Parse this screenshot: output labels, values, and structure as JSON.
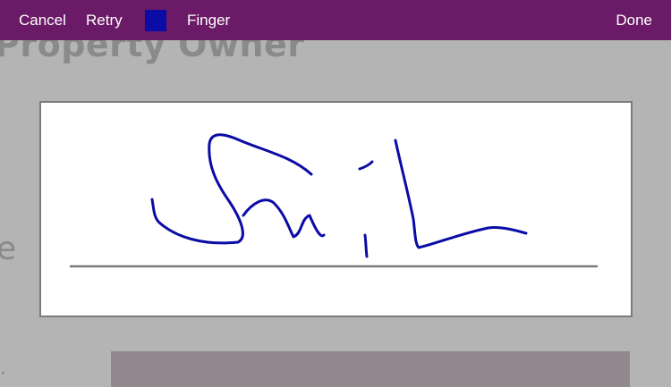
{
  "background": {
    "title": "Property Owner",
    "fragment": "e",
    "fragment_bottom": "·"
  },
  "toolbar": {
    "cancel_label": "Cancel",
    "retry_label": "Retry",
    "pen_color": "#0b0ba6",
    "mode_label": "Finger",
    "done_label": "Done",
    "bar_color": "#6a1a66"
  },
  "signature": {
    "ink_color": "#0b0ba6",
    "baseline_color": "#7b7b7b"
  }
}
